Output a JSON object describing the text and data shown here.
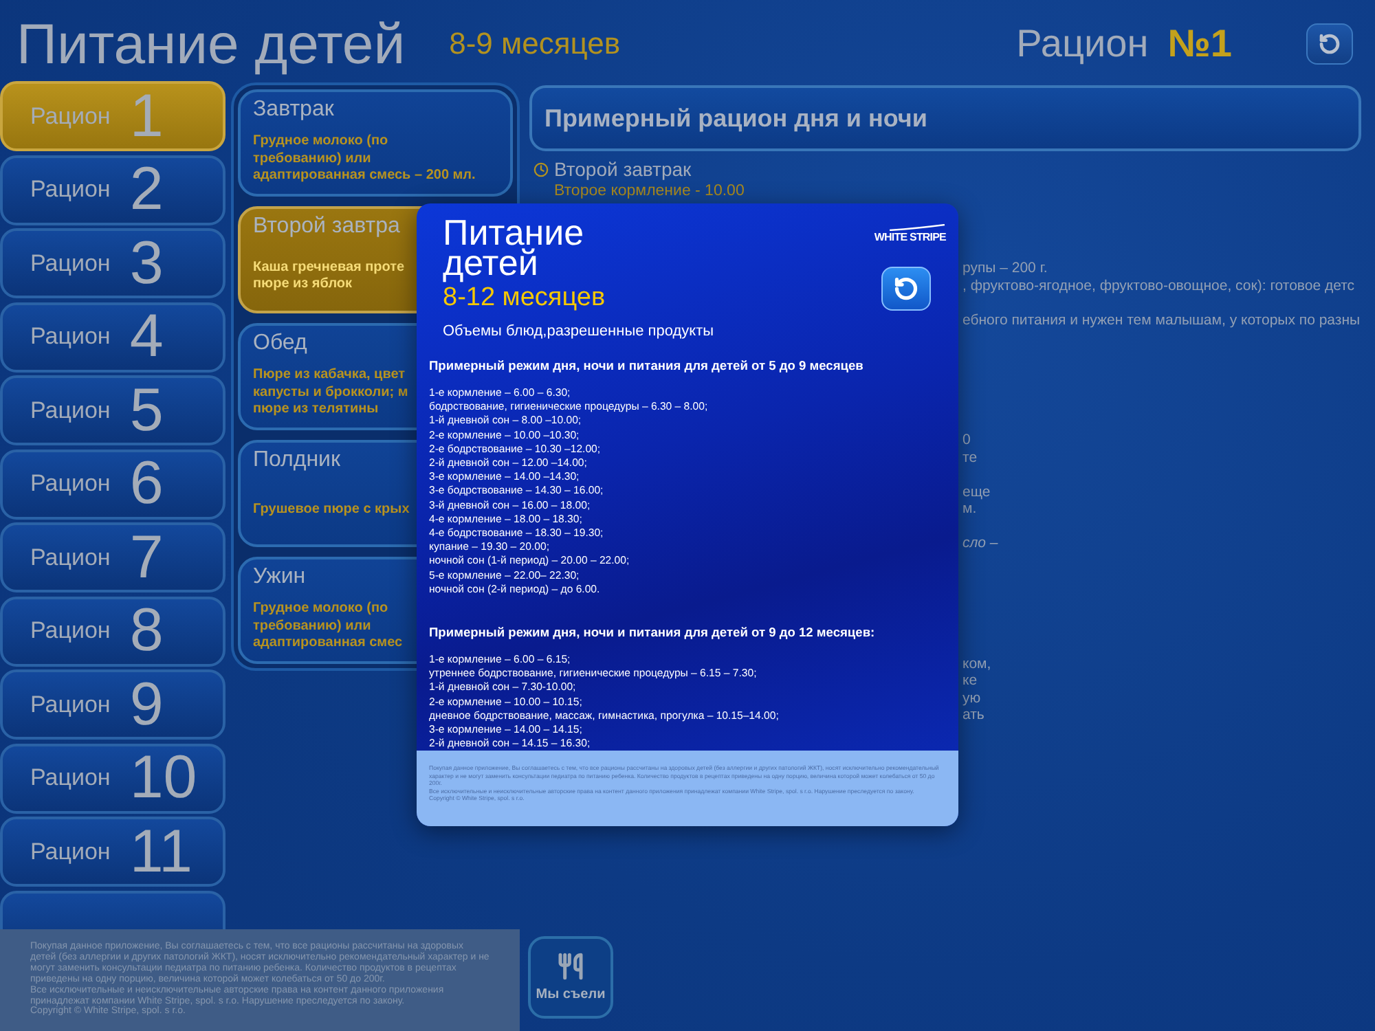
{
  "header": {
    "title": "Питание детей",
    "age": "8-9 месяцев",
    "ration_label": "Рацион",
    "ration_number": "№1"
  },
  "sidebar": {
    "items": [
      {
        "label": "Рацион",
        "number": "1",
        "selected": true
      },
      {
        "label": "Рацион",
        "number": "2",
        "selected": false
      },
      {
        "label": "Рацион",
        "number": "3",
        "selected": false
      },
      {
        "label": "Рацион",
        "number": "4",
        "selected": false
      },
      {
        "label": "Рацион",
        "number": "5",
        "selected": false
      },
      {
        "label": "Рацион",
        "number": "6",
        "selected": false
      },
      {
        "label": "Рацион",
        "number": "7",
        "selected": false
      },
      {
        "label": "Рацион",
        "number": "8",
        "selected": false
      },
      {
        "label": "Рацион",
        "number": "9",
        "selected": false
      },
      {
        "label": "Рацион",
        "number": "10",
        "selected": false
      },
      {
        "label": "Рацион",
        "number": "11",
        "selected": false
      },
      {
        "selected": false
      }
    ]
  },
  "meals": [
    {
      "title": "Завтрак",
      "description_lines": [
        "Грудное молоко (по",
        "требованию) или",
        "адаптированная смесь – 200 мл."
      ],
      "selected": false
    },
    {
      "title": "Второй завтра",
      "description_lines": [
        "Каша гречневая проте",
        "пюре из яблок"
      ],
      "selected": true
    },
    {
      "title": "Обед",
      "description_lines": [
        "Пюре из кабачка, цвет",
        "капусты и брокколи; м",
        "пюре из телятины"
      ],
      "selected": false
    },
    {
      "title": "Полдник",
      "description_lines": [
        "Грушевое пюре с крых"
      ],
      "selected": false
    },
    {
      "title": "Ужин",
      "description_lines": [
        "Грудное молоко (по",
        "требованию) или",
        "адаптированная смес"
      ],
      "selected": false
    }
  ],
  "right_panel": {
    "title": "Примерный рацион дня и ночи",
    "meal": "Второй завтрак",
    "time": "Второе кормление - 10.00",
    "fragments": [
      {
        "lines": [
          "рупы – 200 г.",
          ", фруктово-ягодное, фруктово-овощное, сок): готовое детс"
        ],
        "italic": false
      },
      {
        "lines": [
          "ебного питания и нужен тем малышам, у которых по разны"
        ],
        "italic": false
      },
      {
        "lines": [
          "0",
          "те"
        ],
        "italic": false
      },
      {
        "lines": [
          "еще",
          "м."
        ],
        "italic": false
      },
      {
        "lines": [
          "сло –"
        ],
        "italic": true
      },
      {
        "lines": [
          "ком,",
          "ке",
          "ую",
          "ать"
        ],
        "italic": false
      }
    ]
  },
  "disclaimer": [
    "Покупая данное приложение, Вы соглашаетесь с тем, что все рационы рассчитаны на здоровых детей (без аллергии и других патологий ЖКТ), носят исключительно рекомендательный характер и не могут заменить консультации педиатра по питанию ребенка. Количество продуктов в рецептах приведены на одну порцию, величина которой может колебаться от 50 до 200г.",
    "Все исключительные и неисключительные авторские права на контент данного приложения принадлежат компании White Stripe, spol. s r.o. Нарушение преследуется по закону.",
    "Copyright © White Stripe, spol. s r.o."
  ],
  "eaten_button": {
    "label": "Мы съели"
  },
  "modal": {
    "title": "Питание детей",
    "age": "8-12 месяцев",
    "subtitle": "Объемы блюд,разрешенные продукты",
    "logo": "WHITE STRIPE",
    "sections": [
      {
        "heading": "Примерный режим дня, ночи и питания для детей от 5 до 9 месяцев",
        "lines": [
          "1-е кормление – 6.00 – 6.30;",
          "бодрствование, гигиенические процедуры – 6.30 – 8.00;",
          "1-й дневной сон – 8.00 –10.00;",
          "2-е кормление – 10.00 –10.30;",
          "2-е бодрствование – 10.30 –12.00;",
          "2-й дневной сон – 12.00 –14.00;",
          "3-е кормление – 14.00 –14.30;",
          "3-е бодрствование – 14.30 – 16.00;",
          "3-й дневной сон – 16.00 – 18.00;",
          "4-е кормление – 18.00 – 18.30;",
          "4-е бодрствование – 18.30 – 19.30;",
          "купание – 19.30 – 20.00;",
          "ночной сон (1-й период) – 20.00 – 22.00;",
          "5-е кормление – 22.00– 22.30;",
          "ночной сон (2-й период) – до 6.00."
        ]
      },
      {
        "heading": "Примерный режим дня, ночи и питания для детей от 9 до 12 месяцев:",
        "lines": [
          "1-е кормление – 6.00 – 6.15;",
          "утреннее бодрствование, гигиенические процедуры – 6.15 – 7.30;",
          "1-й дневной сон – 7.30-10.00;",
          "2-е кормление – 10.00 – 10.15;",
          "дневное бодрствование, массаж, гимнастика, прогулка – 10.15–14.00;",
          "3-е кормление – 14.00 – 14.15;",
          "2-й дневной сон – 14.15 – 16.30;"
        ]
      }
    ],
    "footer": [
      "Покупая данное приложение, Вы соглашаетесь с тем, что все рационы рассчитаны на здоровых детей (без аллергии и других патологий ЖКТ), носят исключительно рекомендательный характер и не могут заменить консультации педиатра по питанию ребенка. Количество продуктов в рецептах приведены на одну порцию, величина которой может колебаться от 50 до 200г.",
      "Все исключительные и неисключительные авторские права на контент данного приложения принадлежат компании White Stripe, spol. s r.o. Нарушение преследуется по закону.",
      "Copyright © White Stripe, spol. s r.o."
    ]
  }
}
